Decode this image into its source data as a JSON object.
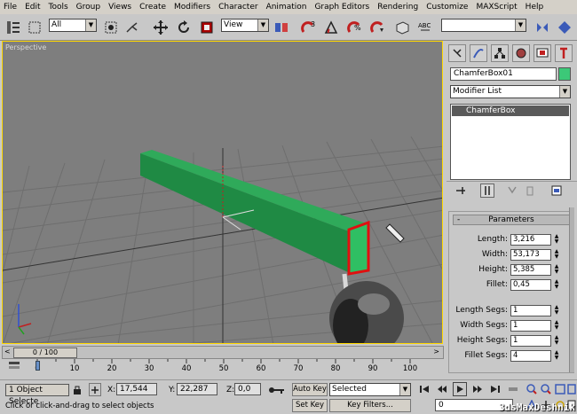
{
  "menu": [
    "File",
    "Edit",
    "Tools",
    "Group",
    "Views",
    "Create",
    "Modifiers",
    "Character",
    "Animation",
    "Graph Editors",
    "Rendering",
    "Customize",
    "MAXScript",
    "Help"
  ],
  "toolbar": {
    "selection_filter": "All",
    "ref_coord": "View"
  },
  "viewport": {
    "label": "Perspective"
  },
  "panel": {
    "object_name": "ChamferBox01",
    "object_color": "#3cc878",
    "modifier_list": "Modifier List",
    "stack_item": "ChamferBox",
    "rollout_title": "Parameters",
    "params": [
      {
        "label": "Length:",
        "value": "3,216"
      },
      {
        "label": "Width:",
        "value": "53,173"
      },
      {
        "label": "Height:",
        "value": "5,385"
      },
      {
        "label": "Fillet:",
        "value": "0,45"
      },
      {
        "label": "Length Segs:",
        "value": "1"
      },
      {
        "label": "Width Segs:",
        "value": "1"
      },
      {
        "label": "Height Segs:",
        "value": "1"
      },
      {
        "label": "Fillet Segs:",
        "value": "4"
      }
    ]
  },
  "timeline": {
    "frame_display": "0 / 100",
    "ticks": [
      "0",
      "10",
      "20",
      "30",
      "40",
      "50",
      "60",
      "70",
      "80",
      "90",
      "100"
    ]
  },
  "status": {
    "selection": "1 Object Selecte",
    "x_label": "X:",
    "x": "17,544",
    "y_label": "Y:",
    "y": "22,287",
    "z_label": "Z:",
    "z": "0,0",
    "prompt": "Click or click-and-drag to select objects",
    "auto_key": "Auto Key",
    "set_key": "Set Key",
    "key_mode": "Selected",
    "key_filters": "Key Filters...",
    "frame": "0",
    "watermark": "3dsMaxDeshnik"
  }
}
